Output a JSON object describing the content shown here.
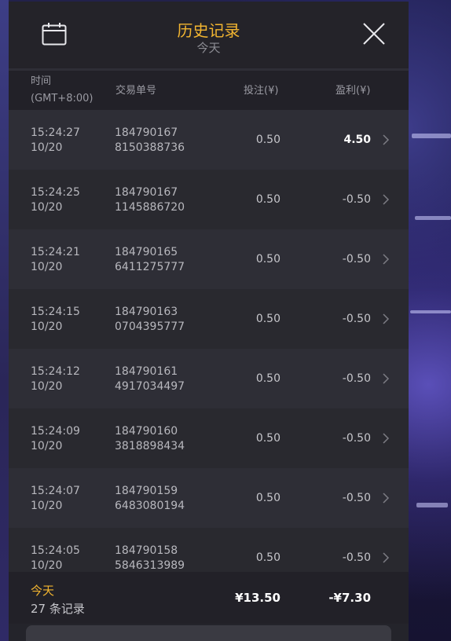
{
  "header": {
    "title": "历史记录",
    "subtitle": "今天"
  },
  "columns": {
    "time_label": "时间",
    "timezone": "(GMT+8:00)",
    "order": "交易单号",
    "bet": "投注(¥)",
    "profit": "盈利(¥)"
  },
  "rows": [
    {
      "time": "15:24:27",
      "date": "10/20",
      "order1": "184790167",
      "order2": "8150388736",
      "bet": "0.50",
      "profit": "4.50",
      "win": true
    },
    {
      "time": "15:24:25",
      "date": "10/20",
      "order1": "184790167",
      "order2": "1145886720",
      "bet": "0.50",
      "profit": "-0.50",
      "win": false
    },
    {
      "time": "15:24:21",
      "date": "10/20",
      "order1": "184790165",
      "order2": "6411275777",
      "bet": "0.50",
      "profit": "-0.50",
      "win": false
    },
    {
      "time": "15:24:15",
      "date": "10/20",
      "order1": "184790163",
      "order2": "0704395777",
      "bet": "0.50",
      "profit": "-0.50",
      "win": false
    },
    {
      "time": "15:24:12",
      "date": "10/20",
      "order1": "184790161",
      "order2": "4917034497",
      "bet": "0.50",
      "profit": "-0.50",
      "win": false
    },
    {
      "time": "15:24:09",
      "date": "10/20",
      "order1": "184790160",
      "order2": "3818898434",
      "bet": "0.50",
      "profit": "-0.50",
      "win": false
    },
    {
      "time": "15:24:07",
      "date": "10/20",
      "order1": "184790159",
      "order2": "6483080194",
      "bet": "0.50",
      "profit": "-0.50",
      "win": false
    },
    {
      "time": "15:24:05",
      "date": "10/20",
      "order1": "184790158",
      "order2": "5846313989",
      "bet": "0.50",
      "profit": "-0.50",
      "win": false
    }
  ],
  "footer": {
    "label": "今天",
    "count": "27 条记录",
    "total_bet": "¥13.50",
    "total_profit": "-¥7.30"
  },
  "colors": {
    "accent": "#f2b530",
    "panel": "#24242b",
    "row_odd": "#2e2e36",
    "row_even": "#29292f"
  },
  "icons": {
    "calendar": "calendar-icon",
    "close": "close-icon",
    "chevron": "chevron-right-icon"
  }
}
